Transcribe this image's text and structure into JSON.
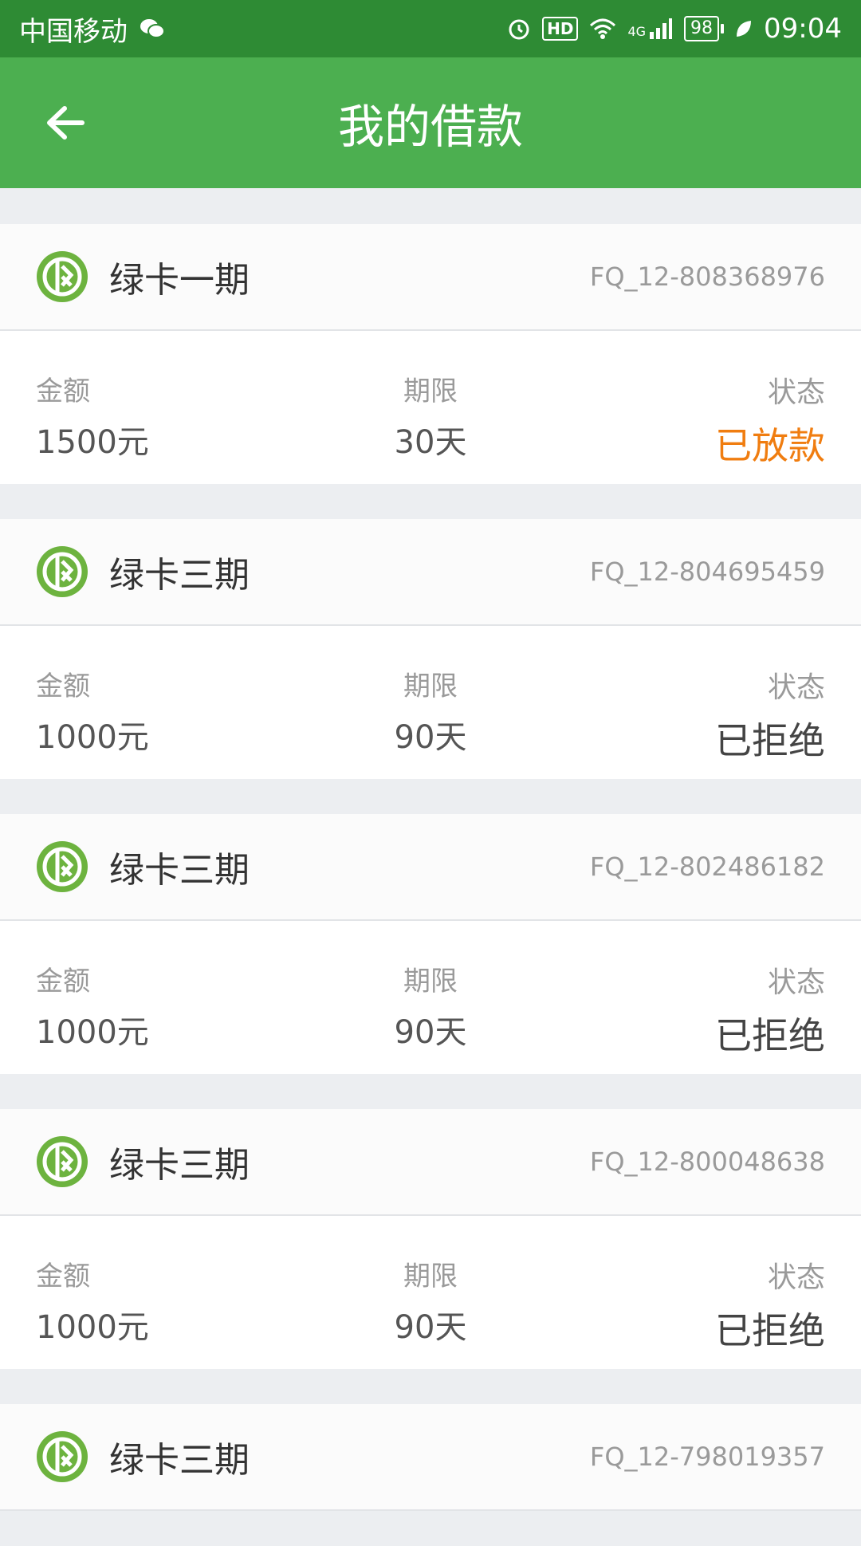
{
  "status_bar": {
    "carrier": "中国移动",
    "hd": "HD",
    "network": "4G",
    "battery": "98",
    "time": "09:04"
  },
  "header": {
    "title": "我的借款"
  },
  "labels": {
    "amount": "金额",
    "term": "期限",
    "status": "状态"
  },
  "loans": [
    {
      "product": "绿卡一期",
      "id": "FQ_12-808368976",
      "amount": "1500元",
      "term": "30天",
      "status": "已放款",
      "status_color": "#f07d10"
    },
    {
      "product": "绿卡三期",
      "id": "FQ_12-804695459",
      "amount": "1000元",
      "term": "90天",
      "status": "已拒绝",
      "status_color": "#444444"
    },
    {
      "product": "绿卡三期",
      "id": "FQ_12-802486182",
      "amount": "1000元",
      "term": "90天",
      "status": "已拒绝",
      "status_color": "#444444"
    },
    {
      "product": "绿卡三期",
      "id": "FQ_12-800048638",
      "amount": "1000元",
      "term": "90天",
      "status": "已拒绝",
      "status_color": "#444444"
    },
    {
      "product": "绿卡三期",
      "id": "FQ_12-798019357",
      "amount": "",
      "term": "",
      "status": "",
      "status_color": "#444444"
    }
  ],
  "colors": {
    "status_bar": "#2e8b34",
    "app_bar": "#4caf50",
    "logo": "#6db33f"
  }
}
